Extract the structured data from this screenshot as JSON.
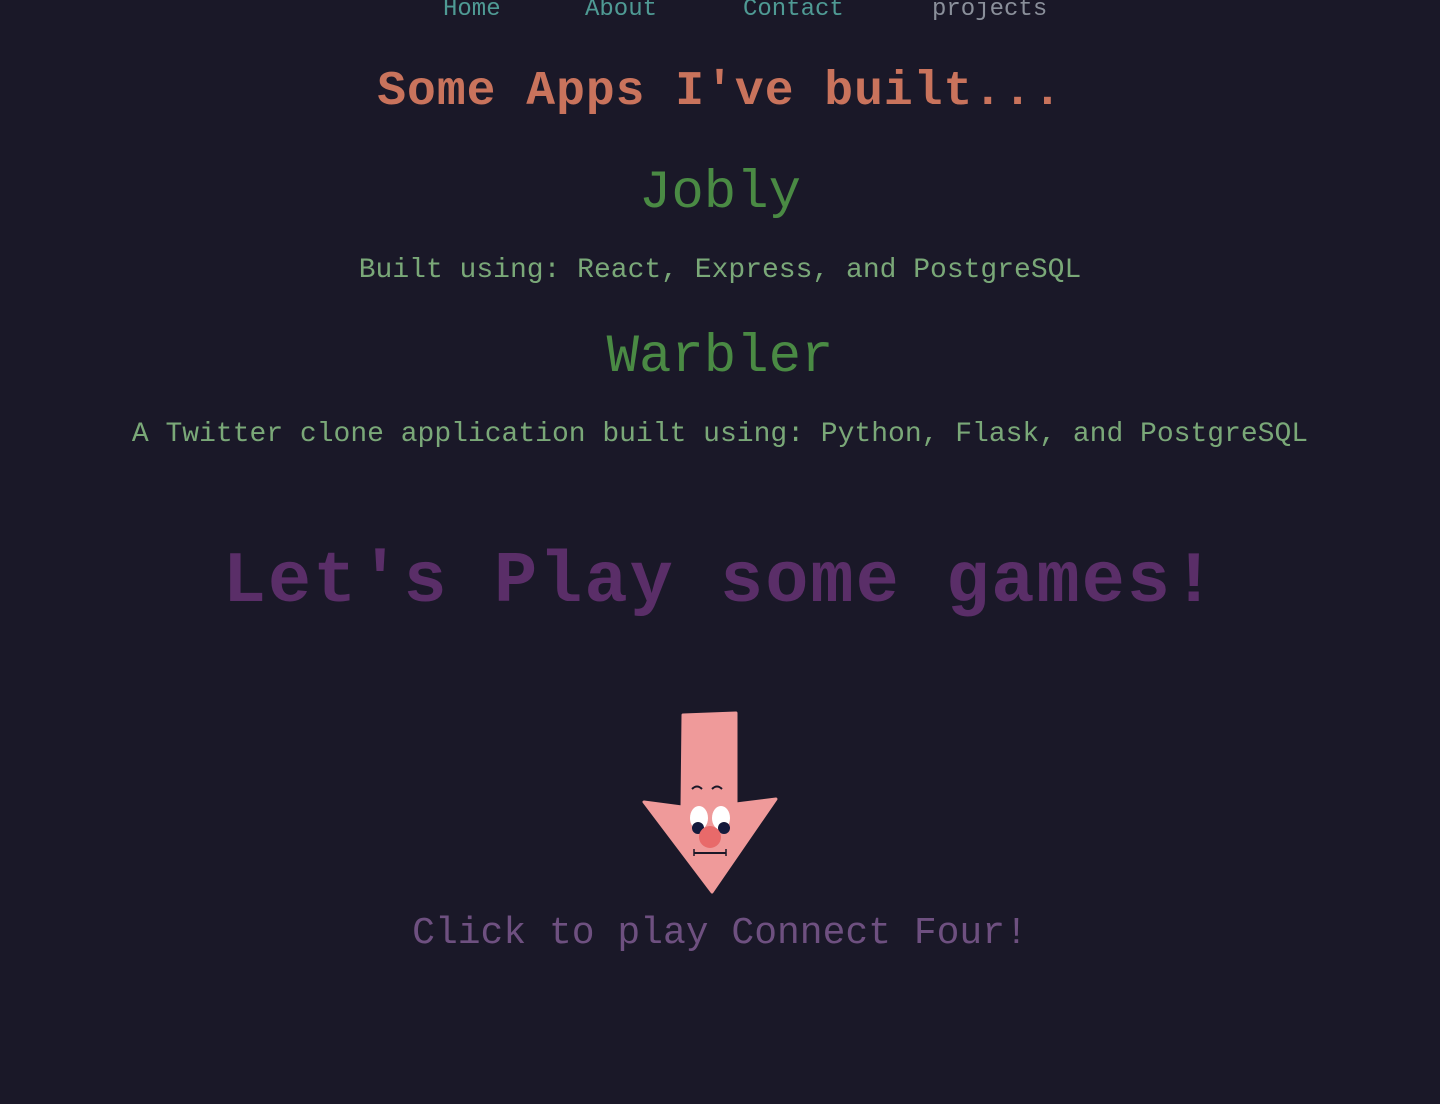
{
  "nav": {
    "items": [
      {
        "label": "Home"
      },
      {
        "label": "About"
      },
      {
        "label": "Contact"
      },
      {
        "label": "projects"
      }
    ]
  },
  "apps": {
    "heading": "Some Apps I've built...",
    "projects": [
      {
        "title": "Jobly",
        "description": "Built using: React, Express, and PostgreSQL"
      },
      {
        "title": "Warbler",
        "description": "A Twitter clone application built using: Python, Flask, and PostgreSQL"
      }
    ]
  },
  "games": {
    "heading": "Let's Play some games!",
    "arrow_icon": "pink-arrow-face-icon",
    "caption": "Click to play Connect Four!"
  },
  "colors": {
    "background": "#1a1828",
    "nav_link": "#4f9a94",
    "nav_active": "#8a8f9a",
    "apps_heading": "#c9735c",
    "project_title": "#4a8a44",
    "project_desc": "#7aa878",
    "games_heading": "#5a2e68",
    "caption": "#6e5080",
    "arrow": "#ef9a9a"
  }
}
